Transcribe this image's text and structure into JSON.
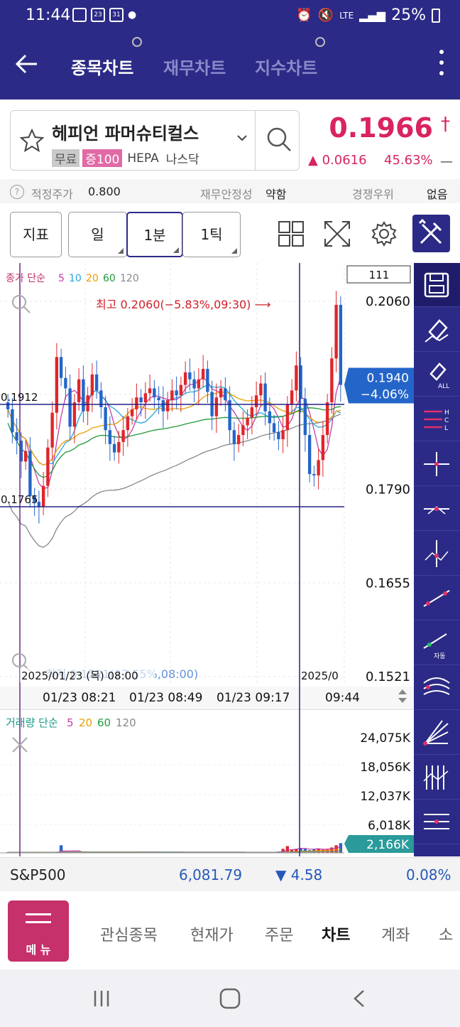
{
  "status_bar": {
    "time": "11:44",
    "notif_date_1": "23",
    "notif_date_2": "31",
    "network": "LTE",
    "battery": "25%"
  },
  "app_bar": {
    "tabs": [
      {
        "label": "종목차트",
        "active": true
      },
      {
        "label": "재무차트",
        "active": false
      },
      {
        "label": "지수차트",
        "active": false
      }
    ]
  },
  "stock": {
    "name": "헤피언 파머슈티컬스",
    "tags": [
      "무료",
      "증100",
      "HEPA",
      "나스닥"
    ],
    "price": "0.1966",
    "price_mark": "†",
    "change": "▲ 0.0616",
    "change_pct": "45.63%",
    "trailing": "—"
  },
  "info_row": {
    "help": "?",
    "fair_price_label": "적정주가",
    "fair_price_value": "0.800",
    "stability_label": "재무안정성",
    "stability_value": "약함",
    "competition_label": "경쟁우위",
    "competition_value": "없음"
  },
  "toolbar": {
    "indicator": "지표",
    "period_day": "일",
    "period_min": "1분",
    "period_tick": "1틱"
  },
  "chart": {
    "indicator_title": "종가 단순",
    "ma_periods": [
      "5",
      "10",
      "20",
      "60",
      "120"
    ],
    "ma_colors": [
      "#c53ca8",
      "#24a8d8",
      "#e8a000",
      "#1f9a3a",
      "#888888"
    ],
    "count_box": "111",
    "high_label": "최고 0.2060(−5.83%,09:30) ⟶",
    "low_label": "최저 0.1521(27.55%,08:00)",
    "crosshair_date": "2025/01/23 (목) 08:00",
    "crosshair_right_date": "2025/0",
    "hline_1_label": "0.1912",
    "hline_2_label": "0.1765",
    "current_price": "0.1940",
    "current_pct": "−4.06%",
    "y_labels": [
      "0.2060",
      "0.1790",
      "0.1655",
      "0.1521"
    ],
    "x_labels": [
      "01/23 08:21",
      "01/23 08:49",
      "01/23 09:17",
      "09:44"
    ],
    "volume_title": "거래량 단순",
    "volume_periods": [
      "5",
      "20",
      "60",
      "120"
    ],
    "volume_colors": [
      "#c53ca8",
      "#e8a000",
      "#1f9a3a",
      "#888888"
    ],
    "volume_y_labels": [
      "24,075K",
      "18,056K",
      "12,037K",
      "6,018K"
    ],
    "volume_current": "2,166K"
  },
  "chart_data": {
    "type": "candlestick",
    "y_axis": {
      "min": 0.1521,
      "max": 0.206,
      "ticks": [
        0.206,
        0.179,
        0.1655,
        0.1521
      ]
    },
    "x_axis_labels": [
      "01/23 08:21",
      "01/23 08:49",
      "01/23 09:17",
      "09:44"
    ],
    "closes": [
      0.1905,
      0.1872,
      0.186,
      0.183,
      0.1845,
      0.178,
      0.1772,
      0.1765,
      0.1795,
      0.185,
      0.19,
      0.198,
      0.195,
      0.1935,
      0.188,
      0.1915,
      0.1948,
      0.1902,
      0.1925,
      0.1955,
      0.1932,
      0.1908,
      0.1875,
      0.1855,
      0.1843,
      0.1858,
      0.1875,
      0.1895,
      0.1905,
      0.1922,
      0.1915,
      0.1928,
      0.1935,
      0.1922,
      0.1918,
      0.1902,
      0.1918,
      0.1932,
      0.1925,
      0.194,
      0.1958,
      0.1948,
      0.1935,
      0.1948,
      0.1963,
      0.193,
      0.1895,
      0.1922,
      0.1935,
      0.1918,
      0.1875,
      0.1855,
      0.1868,
      0.1882,
      0.1893,
      0.1908,
      0.1925,
      0.1942,
      0.1902,
      0.1885,
      0.1872,
      0.1862,
      0.1875,
      0.1912,
      0.1932,
      0.1968,
      0.192,
      0.1868,
      0.1812,
      0.181,
      0.1832,
      0.1868,
      0.1915,
      0.1978,
      0.2055,
      0.194
    ],
    "volumes_k": [
      150,
      130,
      110,
      100,
      90,
      80,
      80,
      100,
      90,
      80,
      90,
      100,
      1700,
      200,
      150,
      120,
      110,
      100,
      90,
      90,
      100,
      110,
      120,
      180,
      160,
      140,
      130,
      130,
      140,
      150,
      300,
      200,
      150,
      140,
      130,
      130,
      150,
      130,
      120,
      120,
      110,
      110,
      120,
      130,
      120,
      110,
      110,
      100,
      100,
      90,
      90,
      90,
      90,
      100,
      90,
      90,
      100,
      100,
      90,
      100,
      200,
      300,
      900,
      1500,
      700,
      800,
      1100,
      900,
      600,
      800,
      1000,
      700,
      900,
      1200,
      1700,
      2166
    ],
    "volume_ylim": [
      0,
      24075
    ],
    "volume_ticks_k": [
      24075,
      18056,
      12037,
      6018
    ],
    "horizontal_lines": [
      0.1912,
      0.1765
    ],
    "high": {
      "value": 0.206,
      "pct": "-5.83%",
      "time": "09:30"
    },
    "low": {
      "value": 0.1521,
      "pct": "27.55%",
      "time": "08:00"
    },
    "current": 0.194,
    "moving_averages": [
      "5",
      "10",
      "20",
      "60",
      "120"
    ]
  },
  "market_bar": {
    "name": "S&P500",
    "value": "6,081.79",
    "change": "▼ 4.58",
    "pct": "0.08%"
  },
  "bottom_nav": {
    "menu_label": "메 뉴",
    "items": [
      "관심종목",
      "현재가",
      "주문",
      "차트",
      "계좌",
      "소"
    ]
  }
}
